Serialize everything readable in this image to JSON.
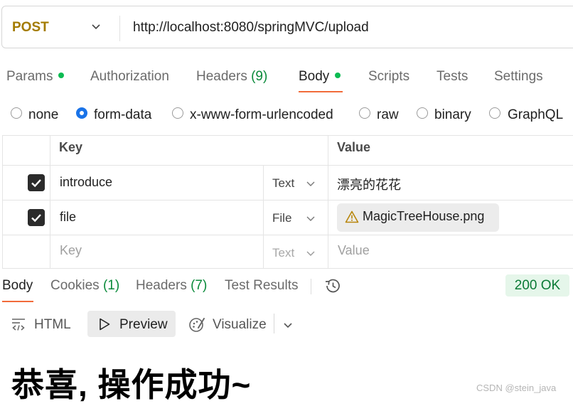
{
  "request": {
    "method": "POST",
    "url": "http://localhost:8080/springMVC/upload"
  },
  "request_tabs": {
    "params": "Params",
    "authorization": "Authorization",
    "headers": "Headers",
    "headers_count": "(9)",
    "body": "Body",
    "scripts": "Scripts",
    "tests": "Tests",
    "settings": "Settings"
  },
  "body_types": {
    "selected": "form-data",
    "options": [
      "none",
      "form-data",
      "x-www-form-urlencoded",
      "raw",
      "binary",
      "GraphQL"
    ]
  },
  "form_table": {
    "headers": {
      "key": "Key",
      "value": "Value"
    },
    "rows": [
      {
        "checked": true,
        "key": "introduce",
        "type": "Text",
        "value": "漂亮的花花"
      },
      {
        "checked": true,
        "key": "file",
        "type": "File",
        "value": "MagicTreeHouse.png"
      }
    ],
    "placeholder": {
      "key": "Key",
      "type": "Text",
      "value": "Value"
    }
  },
  "response_tabs": {
    "body": "Body",
    "cookies": "Cookies",
    "cookies_count": "(1)",
    "headers": "Headers",
    "headers_count": "(7)",
    "test_results": "Test Results"
  },
  "status": "200 OK",
  "view_modes": {
    "html": "HTML",
    "preview": "Preview",
    "visualize": "Visualize"
  },
  "preview_content": "恭喜, 操作成功~",
  "watermark": "CSDN @stein_java",
  "colors": {
    "method": "#a37b00",
    "accent": "#f26b3a",
    "radio_selected": "#1a73e8",
    "status_bg": "#e5f6ea",
    "status_text": "#0a7a35",
    "dot": "#0cbb52"
  },
  "icons": [
    "chevron-down-icon",
    "history-icon",
    "warning-icon",
    "checkbox-checked-icon",
    "code-wrap-icon",
    "play-icon",
    "visualize-icon"
  ]
}
